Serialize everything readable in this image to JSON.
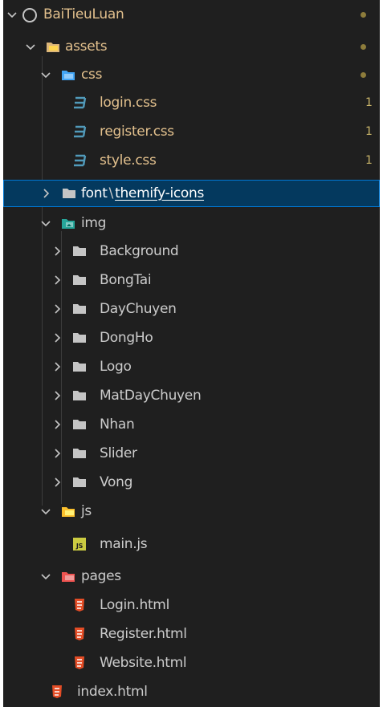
{
  "explorer": {
    "root": {
      "label": "BaiTieuLuan"
    },
    "assets": {
      "label": "assets"
    },
    "css": {
      "label": "css"
    },
    "files": {
      "login_css": {
        "label": "login.css",
        "badge": "1"
      },
      "register_css": {
        "label": "register.css",
        "badge": "1"
      },
      "style_css": {
        "label": "style.css",
        "badge": "1"
      }
    },
    "font": {
      "label": "font",
      "separator": "\\",
      "child": "themify-icons"
    },
    "img": {
      "label": "img",
      "folders": [
        "Background",
        "BongTai",
        "DayChuyen",
        "DongHo",
        "Logo",
        "MatDayChuyen",
        "Nhan",
        "Slider",
        "Vong"
      ]
    },
    "js": {
      "label": "js",
      "file": "main.js"
    },
    "pages": {
      "label": "pages",
      "files": [
        "Login.html",
        "Register.html",
        "Website.html"
      ]
    },
    "index": {
      "label": "index.html"
    }
  },
  "colors": {
    "background": "#1f1f1f",
    "selection": "#04395e",
    "modified_text": "#e2c08d",
    "css_icon": "#519aba",
    "html_icon": "#e44d26",
    "js_icon": "#cbcb41",
    "folder_icon": "#c5c5c5"
  }
}
